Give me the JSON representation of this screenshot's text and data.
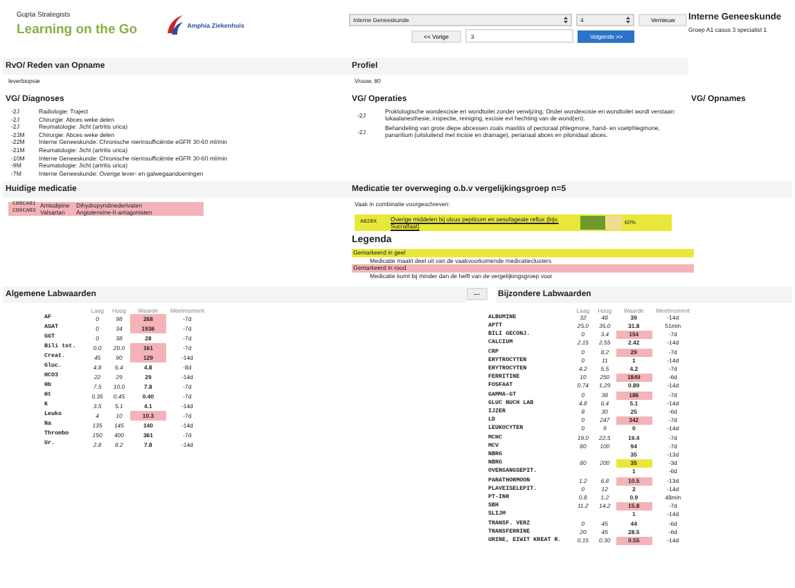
{
  "brand": {
    "company": "Gupta Strategists",
    "title": "Learning on the Go",
    "logo_text": "Amphia Ziekenhuis"
  },
  "controls": {
    "specialism": "Interne Geneeskunde",
    "group": "4",
    "refresh": "Vernieuw",
    "previous": "<< Vorige",
    "case": "3",
    "next": "Volgende >>"
  },
  "case_header": {
    "title": "Interne Geneeskunde",
    "subtitle": "Groep A1 casus 3 specialist 1"
  },
  "reason": {
    "title": "RvO/ Reden van Opname",
    "text": "leverbiopsie"
  },
  "profile": {
    "title": "Profiel",
    "text": "Vrouw, 80"
  },
  "diagnoses": {
    "title": "VG/ Diagnoses",
    "items": [
      {
        "when": "-2J",
        "text": "Radiologie: Traject"
      },
      {
        "when": "-2J",
        "text": "Chirurgie: Abces weke delen"
      },
      {
        "when": "-2J",
        "text": "Reumatologie: Jicht (artritis urica)"
      },
      {
        "when": "-23M",
        "text": "Chirurgie: Abces weke delen"
      },
      {
        "when": "-22M",
        "text": "Interne Geneeskunde: Chronische nierinsufficiëntie eGFR 30-60 ml/min"
      },
      {
        "when": "-21M",
        "text": "Reumatologie: Jicht (artritis urica)"
      },
      {
        "when": "-10M",
        "text": "Interne Geneeskunde: Chronische nierinsufficiëntie eGFR 30-60 ml/min"
      },
      {
        "when": "-9M",
        "text": "Reumatologie: Jicht (artritis urica)"
      },
      {
        "when": "-7M",
        "text": "Interne Geneeskunde: Overige lever- en galwegaandoeningen"
      }
    ]
  },
  "operations": {
    "title": "VG/ Operaties",
    "items": [
      {
        "when": "-2J",
        "text": "Proktologische wondexcisie en wondtoilet zonder verwijzing. Onder wondexcisie en wondtoilet wordt verstaan: lokaalanesthesie, inspectie, reiniging, excisie evt hechting van de wond(en)."
      },
      {
        "when": "-2J",
        "text": "Behandeling van grote diepe abcessen zoals mastitis of pectoraal phlegmone, hand- en voetphlegmone, panaritium (uitsluitend met incisie en drainage), perianaal abces en pilonidaal abces."
      }
    ]
  },
  "admissions": {
    "title": "VG/ Opnames"
  },
  "current_medication": {
    "title": "Huidige medicatie",
    "items": [
      {
        "code": "C08CA01",
        "name": "Amlodipine",
        "group": "Dihydropyridinederivaten",
        "color": "#f3b3b8"
      },
      {
        "code": "C09CA03",
        "name": "Valsartan",
        "group": "Angiotensine-II-antagonisten",
        "color": "#f3b3b8"
      }
    ]
  },
  "suggested_medication": {
    "title": "Medicatie ter overweging o.b.v vergelijkingsgroep n=5",
    "intro": "Vaak in combinatie voorgeschreven:",
    "items": [
      {
        "code": "A02BX",
        "name": "Overige middelen bij ulcus pepticum en oesofageale reflux (bijv. Sucralfaat)",
        "share": "60%",
        "level": 0.6,
        "color": "#e8e83a"
      }
    ]
  },
  "legend": {
    "title": "Legenda",
    "items": [
      {
        "label": "Gemarkeerd in geel",
        "description": "Medicatie maakt deel uit van de vaakvoorkomende medicatieclusters",
        "color": "#e8e83a"
      },
      {
        "label": "Gemarkeerd in rood",
        "description": "Medicatie komt bij minder dan de helft van de vergelijkingsgroep voor",
        "color": "#f3b3b8"
      }
    ]
  },
  "toggle": "—",
  "general_labs": {
    "title": "Algemene Labwaarden",
    "columns": [
      "Laag",
      "Hoog",
      "Waarde",
      "Meetmoment"
    ],
    "rows": [
      {
        "name": "AF",
        "low": "0",
        "high": "98",
        "value": "268",
        "time": "-7d",
        "color": "#f3b3b8"
      },
      {
        "name": "ASAT",
        "low": "0",
        "high": "34",
        "value": "1936",
        "time": "-7d",
        "color": "#f3b3b8"
      },
      {
        "name": "GGT",
        "low": "0",
        "high": "38",
        "value": "28",
        "time": "-7d"
      },
      {
        "name": "Bili tot.",
        "low": "0.0",
        "high": "20.0",
        "value": "161",
        "time": "-7d",
        "color": "#f3b3b8"
      },
      {
        "name": "Creat.",
        "low": "45",
        "high": "90",
        "value": "129",
        "time": "-14d",
        "color": "#f3b3b8"
      },
      {
        "name": "Gluc.",
        "low": "4.8",
        "high": "6.4",
        "value": "4.8",
        "time": "-8d"
      },
      {
        "name": "HCO3",
        "low": "22",
        "high": "29",
        "value": "29",
        "time": "-14d"
      },
      {
        "name": "Hb",
        "low": "7.5",
        "high": "10.0",
        "value": "7.8",
        "time": "-7d"
      },
      {
        "name": "Ht",
        "low": "0.35",
        "high": "0.45",
        "value": "0.40",
        "time": "-7d"
      },
      {
        "name": "K",
        "low": "3.5",
        "high": "5.1",
        "value": "4.1",
        "time": "-14d"
      },
      {
        "name": "Leuko",
        "low": "4",
        "high": "10",
        "value": "10.3",
        "time": "-7d",
        "color": "#f3b3b8"
      },
      {
        "name": "Na",
        "low": "135",
        "high": "145",
        "value": "140",
        "time": "-14d"
      },
      {
        "name": "Thrombo",
        "low": "150",
        "high": "400",
        "value": "361",
        "time": "-7d"
      },
      {
        "name": "Ur.",
        "low": "2.8",
        "high": "8.2",
        "value": "7.8",
        "time": "-14d"
      }
    ]
  },
  "special_labs": {
    "title": "Bijzondere Labwaarden",
    "columns": [
      "Laag",
      "Hoog",
      "Waarde",
      "Meetmoment"
    ],
    "rows": [
      {
        "name": "ALBUMINE",
        "low": "32",
        "high": "48",
        "value": "39",
        "time": "-14d"
      },
      {
        "name": "APTT",
        "low": "25.0",
        "high": "35.0",
        "value": "31.8",
        "time": "51min"
      },
      {
        "name": "BILI GECONJ.",
        "low": "0",
        "high": "3.4",
        "value": "154",
        "time": "-7d",
        "color": "#f3b3b8"
      },
      {
        "name": "CALCIUM",
        "low": "2.15",
        "high": "2.55",
        "value": "2.42",
        "time": "-14d"
      },
      {
        "name": "CRP",
        "low": "0",
        "high": "8.2",
        "value": "29",
        "time": "-7d",
        "color": "#f3b3b8"
      },
      {
        "name": "ERYTROCYTEN",
        "low": "0",
        "high": "11",
        "value": "1",
        "time": "-14d"
      },
      {
        "name": "ERYTROCYTEN",
        "low": "4.2",
        "high": "5.5",
        "value": "4.2",
        "time": "-7d"
      },
      {
        "name": "FERRITINE",
        "low": "10",
        "high": "250",
        "value": "1849",
        "time": "-6d",
        "color": "#f3b3b8"
      },
      {
        "name": "FOSFAAT",
        "low": "0.74",
        "high": "1.29",
        "value": "0.89",
        "time": "-14d"
      },
      {
        "name": "GAMMA-GT",
        "low": "0",
        "high": "38",
        "value": "186",
        "time": "-7d",
        "color": "#f3b3b8"
      },
      {
        "name": "GLUC NUCH LAB",
        "low": "4.8",
        "high": "6.4",
        "value": "5.1",
        "time": "-14d"
      },
      {
        "name": "IJZER",
        "low": "8",
        "high": "30",
        "value": "25",
        "time": "-6d"
      },
      {
        "name": "LD",
        "low": "0",
        "high": "247",
        "value": "342",
        "time": "-7d",
        "color": "#f3b3b8"
      },
      {
        "name": "LEUKOCYTEN",
        "low": "0",
        "high": "9",
        "value": "0",
        "time": "-14d"
      },
      {
        "name": "MCHC",
        "low": "19.0",
        "high": "22.5",
        "value": "19.4",
        "time": "-7d"
      },
      {
        "name": "MCV",
        "low": "80",
        "high": "100",
        "value": "94",
        "time": "-7d"
      },
      {
        "name": "NBRG",
        "value": "35",
        "time": "-13d"
      },
      {
        "name": "NBRG",
        "low": "80",
        "high": "200",
        "value": "35",
        "time": "-3d",
        "color": "#e8e83a"
      },
      {
        "name": "OVERGANGSEPIT.",
        "value": "1",
        "time": "-6d"
      },
      {
        "name": "PARATHORMOON",
        "low": "1.2",
        "high": "6.8",
        "value": "10.5",
        "time": "-13d",
        "color": "#f3b3b8"
      },
      {
        "name": "PLAVEISELEPIT.",
        "low": "0",
        "high": "12",
        "value": "2",
        "time": "-14d"
      },
      {
        "name": "PT-INR",
        "low": "0.8",
        "high": "1.2",
        "value": "0.9",
        "time": "48min"
      },
      {
        "name": "SBH",
        "low": "11.2",
        "high": "14.2",
        "value": "15.8",
        "time": "-7d",
        "color": "#f3b3b8"
      },
      {
        "name": "SLIJM",
        "value": "1",
        "time": "-14d"
      },
      {
        "name": "TRANSF. VERZ",
        "low": "0",
        "high": "45",
        "value": "44",
        "time": "-6d"
      },
      {
        "name": "TRANSFERRINE",
        "low": "20",
        "high": "45",
        "value": "28.5",
        "time": "-6d"
      },
      {
        "name": "URINE, EIWIT KREAT R.",
        "low": "0.15",
        "high": "0.30",
        "value": "0.55",
        "time": "-14d",
        "color": "#f3b3b8"
      }
    ]
  }
}
